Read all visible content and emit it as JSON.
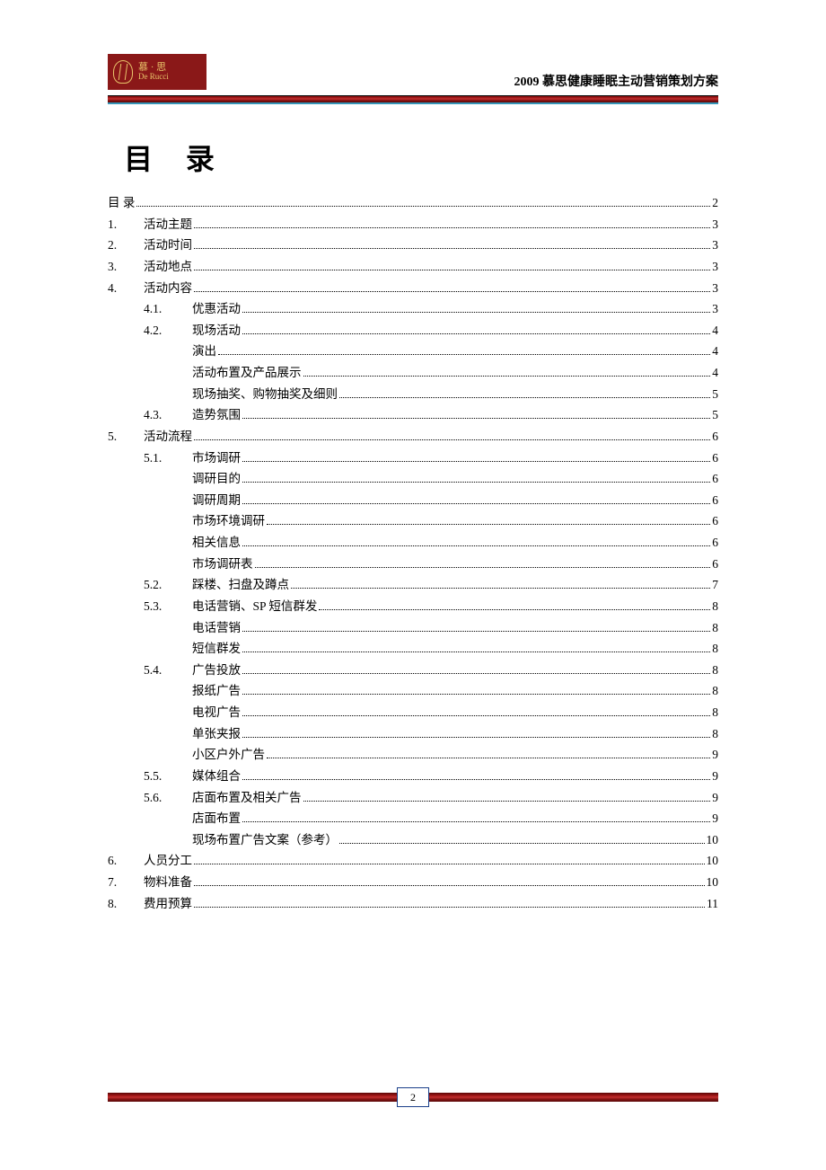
{
  "header": {
    "brand_line1": "慕 · 思",
    "brand_line2": "De Rucci",
    "doc_title": "2009 慕思健康睡眠主动营销策划方案"
  },
  "toc_heading": "目 录",
  "footer_page": "2",
  "toc": [
    {
      "level": "root",
      "num": "",
      "label": "目 录",
      "page": "2"
    },
    {
      "level": "0",
      "num": "1.",
      "label": "活动主题",
      "page": "3"
    },
    {
      "level": "0",
      "num": "2.",
      "label": "活动时间",
      "page": "3"
    },
    {
      "level": "0",
      "num": "3.",
      "label": "活动地点",
      "page": "3"
    },
    {
      "level": "0",
      "num": "4.",
      "label": "活动内容",
      "page": "3"
    },
    {
      "level": "1",
      "num": "4.1.",
      "label": "优惠活动",
      "page": "3"
    },
    {
      "level": "1",
      "num": "4.2.",
      "label": "现场活动",
      "page": "4"
    },
    {
      "level": "2",
      "num": "",
      "label": "演出",
      "page": "4"
    },
    {
      "level": "2",
      "num": "",
      "label": "活动布置及产品展示",
      "page": "4"
    },
    {
      "level": "2",
      "num": "",
      "label": "现场抽奖、购物抽奖及细则",
      "page": "5"
    },
    {
      "level": "1",
      "num": "4.3.",
      "label": "造势氛围",
      "page": "5"
    },
    {
      "level": "0",
      "num": "5.",
      "label": "活动流程",
      "page": "6"
    },
    {
      "level": "1",
      "num": "5.1.",
      "label": "市场调研",
      "page": "6"
    },
    {
      "level": "2",
      "num": "",
      "label": "调研目的",
      "page": "6"
    },
    {
      "level": "2",
      "num": "",
      "label": "调研周期",
      "page": "6"
    },
    {
      "level": "2",
      "num": "",
      "label": "市场环境调研",
      "page": "6"
    },
    {
      "level": "2",
      "num": "",
      "label": "相关信息",
      "page": "6"
    },
    {
      "level": "2",
      "num": "",
      "label": "市场调研表",
      "page": "6"
    },
    {
      "level": "1",
      "num": "5.2.",
      "label": "踩楼、扫盘及蹲点",
      "page": "7"
    },
    {
      "level": "1",
      "num": "5.3.",
      "label": "电话营销、SP 短信群发",
      "page": "8"
    },
    {
      "level": "2",
      "num": "",
      "label": "电话营销",
      "page": "8"
    },
    {
      "level": "2",
      "num": "",
      "label": "短信群发",
      "page": "8"
    },
    {
      "level": "1",
      "num": "5.4.",
      "label": "广告投放",
      "page": "8"
    },
    {
      "level": "2",
      "num": "",
      "label": "报纸广告",
      "page": "8"
    },
    {
      "level": "2",
      "num": "",
      "label": "电视广告",
      "page": "8"
    },
    {
      "level": "2",
      "num": "",
      "label": "单张夹报",
      "page": "8"
    },
    {
      "level": "2",
      "num": "",
      "label": "小区户外广告",
      "page": "9"
    },
    {
      "level": "1",
      "num": "5.5.",
      "label": "媒体组合",
      "page": "9"
    },
    {
      "level": "1",
      "num": "5.6.",
      "label": "店面布置及相关广告",
      "page": "9"
    },
    {
      "level": "2",
      "num": "",
      "label": "店面布置",
      "page": "9"
    },
    {
      "level": "2",
      "num": "",
      "label": "现场布置广告文案（参考）",
      "page": "10"
    },
    {
      "level": "0",
      "num": "6.",
      "label": "人员分工",
      "page": "10"
    },
    {
      "level": "0",
      "num": "7.",
      "label": "物料准备",
      "page": "10"
    },
    {
      "level": "0",
      "num": "8.",
      "label": "费用预算",
      "page": "11"
    }
  ]
}
